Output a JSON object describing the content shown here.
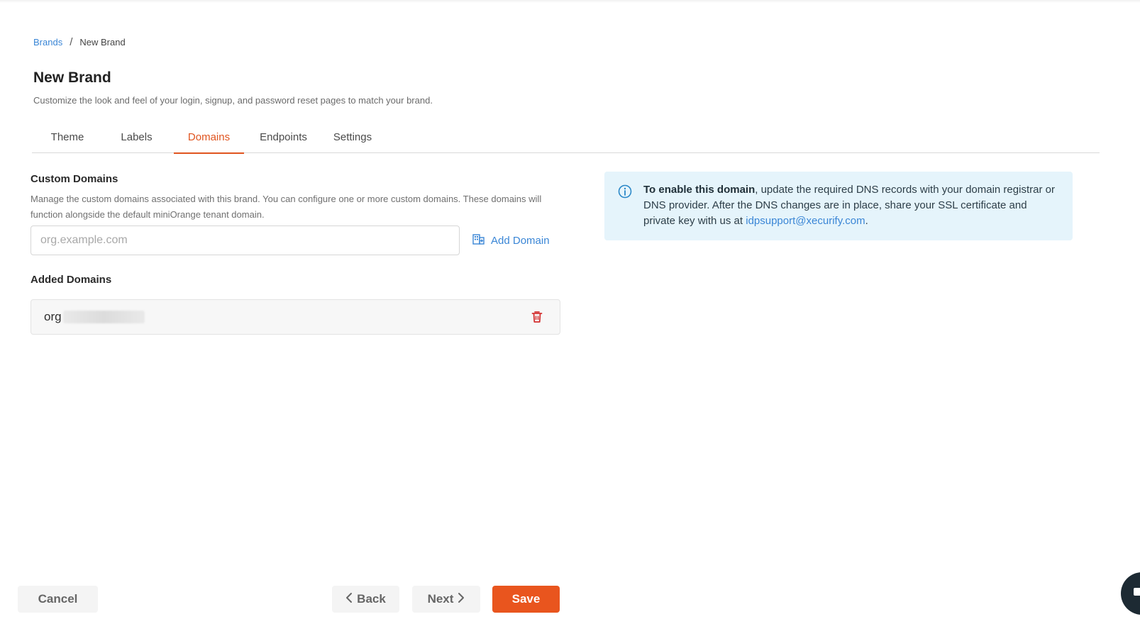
{
  "breadcrumb": {
    "parent": "Brands",
    "separator": "/",
    "current": "New Brand"
  },
  "page": {
    "title": "New Brand",
    "subtitle": "Customize the look and feel of your login, signup, and password reset pages to match your brand."
  },
  "tabs": [
    {
      "label": "Theme"
    },
    {
      "label": "Labels"
    },
    {
      "label": "Domains",
      "active": true
    },
    {
      "label": "Endpoints"
    },
    {
      "label": "Settings"
    }
  ],
  "custom_domains": {
    "title": "Custom Domains",
    "description": "Manage the custom domains associated with this brand. You can configure one or more custom domains. These domains will function alongside the default miniOrange tenant domain.",
    "input_value": "",
    "input_placeholder": "org.example.com",
    "add_label": "Add Domain",
    "add_icon": "building-add-icon"
  },
  "added_domains": {
    "title": "Added Domains",
    "items": [
      {
        "domain": "org"
      }
    ],
    "delete_icon": "trash-icon"
  },
  "info": {
    "icon": "info-icon",
    "bold": "To enable this domain",
    "text": ", update the required DNS records with your domain registrar or DNS provider. After the DNS changes are in place, share your SSL certificate and private key with us at ",
    "email": "idpsupport@xecurify.com",
    "end": "."
  },
  "footer": {
    "cancel": "Cancel",
    "back": "Back",
    "next": "Next",
    "save": "Save"
  },
  "colors": {
    "accent": "#e9551e",
    "link": "#3a86d6",
    "info_bg": "#e5f4fb",
    "delete": "#d32f2f"
  }
}
